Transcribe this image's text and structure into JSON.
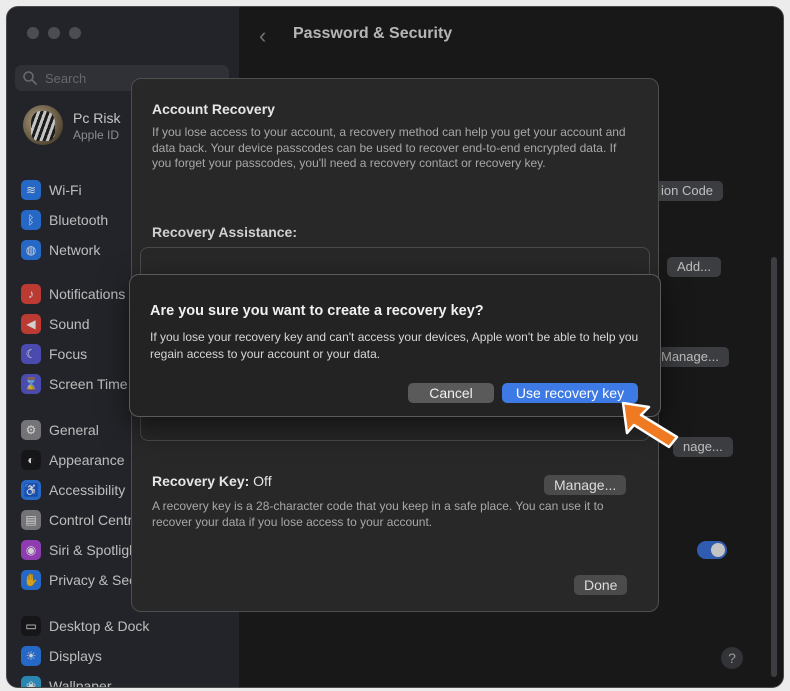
{
  "sidebar": {
    "search_placeholder": "Search",
    "account": {
      "name": "Pc Risk",
      "subtitle": "Apple ID"
    },
    "items": [
      {
        "label": "Wi-Fi",
        "icon": "wifi-icon",
        "color": "#2f7ff2",
        "glyph": "≋"
      },
      {
        "label": "Bluetooth",
        "icon": "bluetooth-icon",
        "color": "#2f7ff2",
        "glyph": "ᛒ"
      },
      {
        "label": "Network",
        "icon": "network-icon",
        "color": "#2f7ff2",
        "glyph": "◍"
      },
      {
        "label": "Notifications",
        "icon": "bell-icon",
        "color": "#e5483e",
        "glyph": "♪"
      },
      {
        "label": "Sound",
        "icon": "speaker-icon",
        "color": "#e5483e",
        "glyph": "◀"
      },
      {
        "label": "Focus",
        "icon": "moon-icon",
        "color": "#5b5bd6",
        "glyph": "☾"
      },
      {
        "label": "Screen Time",
        "icon": "hourglass-icon",
        "color": "#5b5bd6",
        "glyph": "⌛"
      },
      {
        "label": "General",
        "icon": "gear-icon",
        "color": "#8e8e93",
        "glyph": "⚙"
      },
      {
        "label": "Appearance",
        "icon": "appearance-icon",
        "color": "#1c1c1e",
        "glyph": "◐"
      },
      {
        "label": "Accessibility",
        "icon": "accessibility-icon",
        "color": "#2f7ff2",
        "glyph": "♿"
      },
      {
        "label": "Control Centre",
        "icon": "control-centre-icon",
        "color": "#8e8e93",
        "glyph": "▤"
      },
      {
        "label": "Siri & Spotlight",
        "icon": "siri-icon",
        "color": "#b04ad8",
        "glyph": "◉"
      },
      {
        "label": "Privacy & Security",
        "icon": "hand-icon",
        "color": "#2f7ff2",
        "glyph": "✋"
      },
      {
        "label": "Desktop & Dock",
        "icon": "dock-icon",
        "color": "#1c1c1e",
        "glyph": "▭"
      },
      {
        "label": "Displays",
        "icon": "sun-icon",
        "color": "#2f7ff2",
        "glyph": "☀"
      },
      {
        "label": "Wallpaper",
        "icon": "wallpaper-icon",
        "color": "#34a4d8",
        "glyph": "❀"
      }
    ]
  },
  "main": {
    "title": "Password & Security",
    "bg_buttons": {
      "verification_code": "ion Code",
      "add": "Add...",
      "manage1": "Manage...",
      "manage2": "nage..."
    }
  },
  "sheet": {
    "title": "Account Recovery",
    "description": "If you lose access to your account, a recovery method can help you get your account and data back. Your device passcodes can be used to recover end-to-end encrypted data. If you forget your passcodes, you'll need a recovery contact or recovery key.",
    "recovery_assistance_title": "Recovery Assistance:",
    "recovery_key_label": "Recovery Key:",
    "recovery_key_status": "Off",
    "manage_button": "Manage...",
    "recovery_key_description": "A recovery key is a 28-character code that you keep in a safe place. You can use it to recover your data if you lose access to your account.",
    "done_button": "Done"
  },
  "alert": {
    "question": "Are you sure you want to create a recovery key?",
    "message": "If you lose your recovery key and can't access your devices, Apple won't be able to help you regain access to your account or your data.",
    "cancel": "Cancel",
    "confirm": "Use recovery key"
  },
  "colors": {
    "accent": "#3d7ae5",
    "annotation_arrow": "#f07a22"
  }
}
